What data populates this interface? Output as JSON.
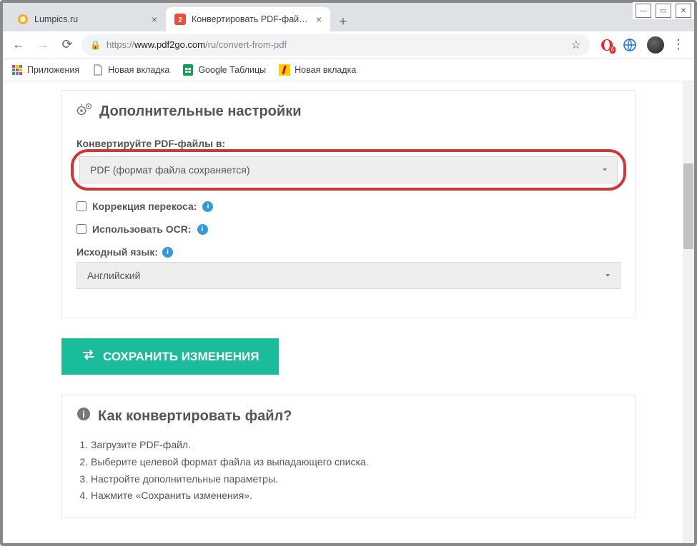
{
  "window": {
    "tabs": [
      {
        "title": "Lumpics.ru",
        "active": false
      },
      {
        "title": "Конвертировать PDF-файл — К",
        "active": true
      }
    ],
    "url_prefix": "https://",
    "url_host": "www.pdf2go.com",
    "url_path": "/ru/convert-from-pdf",
    "ext_badge": "6"
  },
  "bookmarks": [
    "Приложения",
    "Новая вкладка",
    "Google Таблицы",
    "Новая вкладка"
  ],
  "settings": {
    "heading": "Дополнительные настройки",
    "convert_label": "Конвертируйте PDF-файлы в:",
    "convert_value": "PDF (формат файла сохраняется)",
    "deskew_label": "Коррекция перекоса:",
    "ocr_label": "Использовать OCR:",
    "lang_label": "Исходный язык:",
    "lang_value": "Английский"
  },
  "save_button": "СОХРАНИТЬ ИЗМЕНЕНИЯ",
  "how": {
    "heading": "Как конвертировать файл?",
    "steps": [
      "Загрузите PDF-файл.",
      "Выберите целевой формат файла из выпадающего списка.",
      "Настройте дополнительные параметры.",
      "Нажмите «Сохранить изменения»."
    ]
  }
}
